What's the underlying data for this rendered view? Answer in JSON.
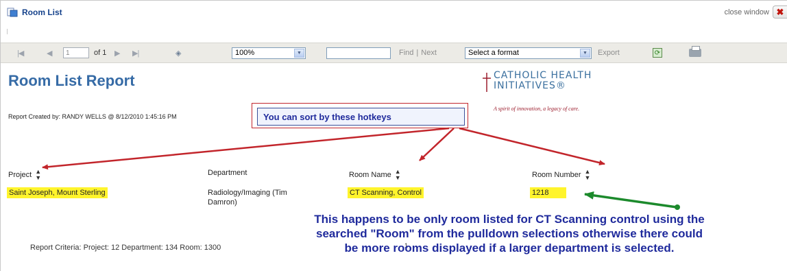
{
  "window": {
    "title": "Room List",
    "close_label": "close window",
    "close_glyph": "✖"
  },
  "toolbar": {
    "page_value": "1",
    "of_pages": "of 1",
    "zoom": "100%",
    "find_label": "Find",
    "separator": "|",
    "next_label": "Next",
    "format_placeholder": "Select a format",
    "export_label": "Export"
  },
  "report": {
    "title": "Room List Report",
    "created": "Report Created by: RANDY WELLS @ 8/12/2010 1:45:16 PM",
    "logo_line1": "CATHOLIC HEALTH",
    "logo_line2": "INITIATIVES®",
    "tagline": "A spirit of innovation, a legacy of care.",
    "columns": [
      "Project",
      "Department",
      "Room Name",
      "Room Number"
    ],
    "row": {
      "project": "Saint Joseph, Mount Sterling",
      "department_line1": "Radiology/Imaging (Tim",
      "department_line2": "Damron)",
      "room_name": "CT Scanning, Control",
      "room_number": "1218"
    },
    "criteria": "Report Criteria:  Project: 12  Department: 134  Room: 1300",
    "page_number": "1"
  },
  "annotations": {
    "callout": "You can sort by these hotkeys",
    "note_line1": "This happens to be only room listed for CT Scanning control using the",
    "note_line2": "searched \"Room\" from the pulldown selections otherwise there could",
    "note_line3": "be more rooms displayed if a larger department is selected."
  },
  "colors": {
    "highlight": "#fff42c",
    "arrow_red": "#c2252b",
    "arrow_green": "#1c8a2c",
    "title_blue": "#366ba6",
    "note_blue": "#1f2a9c"
  }
}
